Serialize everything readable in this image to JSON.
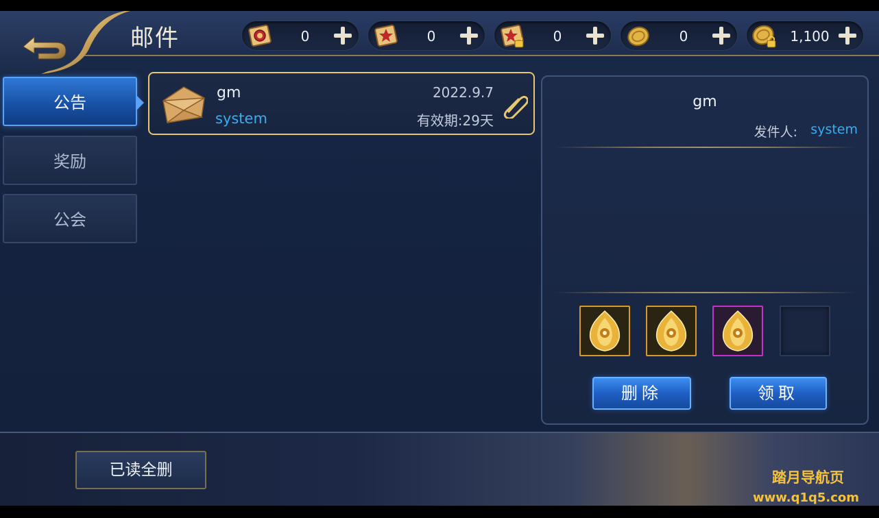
{
  "header": {
    "title": "邮件",
    "currencies": [
      {
        "icon": "red-scroll-icon",
        "value": "0"
      },
      {
        "icon": "star-scroll-icon",
        "value": "0"
      },
      {
        "icon": "locked-scroll-icon",
        "value": "0"
      },
      {
        "icon": "gold-coin-icon",
        "value": "0"
      },
      {
        "icon": "locked-gold-coin-icon",
        "value": "1,100"
      }
    ]
  },
  "tabs": [
    {
      "label": "公告",
      "active": true
    },
    {
      "label": "奖励",
      "active": false
    },
    {
      "label": "公会",
      "active": false
    }
  ],
  "mail_list": [
    {
      "sender": "gm",
      "from": "system",
      "date": "2022.9.7",
      "expiry": "有效期:29天",
      "has_attachment": true
    }
  ],
  "detail": {
    "title": "gm",
    "sender_label": "发件人:",
    "sender_value": "system",
    "attachments": [
      {
        "icon": "golden-flame-egg-icon",
        "rarity": "gold"
      },
      {
        "icon": "golden-flame-egg-icon",
        "rarity": "gold"
      },
      {
        "icon": "golden-flame-egg-icon",
        "rarity": "purple"
      },
      {
        "icon": "",
        "rarity": "empty"
      }
    ],
    "delete_label": "删除",
    "claim_label": "领取"
  },
  "footer": {
    "read_delete_all_label": "已读全删"
  },
  "watermark": {
    "title": "踏月导航页",
    "url": "www.q1q5.com"
  },
  "colors": {
    "accent_blue": "#35aef2",
    "gold_border": "#e7c772",
    "gold_rarity": "#d89a27",
    "purple_rarity": "#c532c9",
    "watermark": "#f5c23c"
  }
}
